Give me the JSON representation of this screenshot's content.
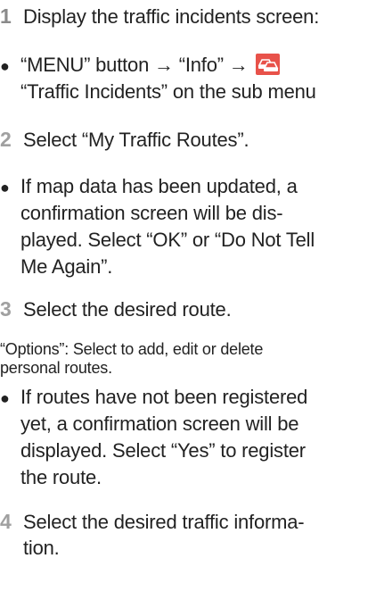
{
  "steps": [
    {
      "num": "1",
      "text": "Display the traffic incidents screen:"
    },
    {
      "num": "2",
      "text": "Select “My Traffic Routes”."
    },
    {
      "num": "3",
      "text": "Select the desired route."
    },
    {
      "num": "4",
      "text_line1": "Select the desired traffic informa-",
      "text_line2": "tion."
    }
  ],
  "bullets": {
    "b1_line1_pre": "“MENU” button → “Info” →",
    "b1_line2": "“Traffic Incidents” on the sub menu",
    "b2_lines": [
      "If map data has been updated, a",
      "confirmation screen will be dis-",
      "played. Select “OK” or “Do Not Tell",
      "Me Again”."
    ],
    "b3_lines": [
      "If routes have not been registered",
      "yet, a confirmation screen will be",
      "displayed. Select “Yes” to register",
      "the route."
    ]
  },
  "note_lines": [
    "“Options”: Select to add, edit or delete",
    "personal routes."
  ],
  "icons": {
    "bullet": "●",
    "traffic": "traffic-cars-icon",
    "traffic_color": "#e8524a"
  }
}
